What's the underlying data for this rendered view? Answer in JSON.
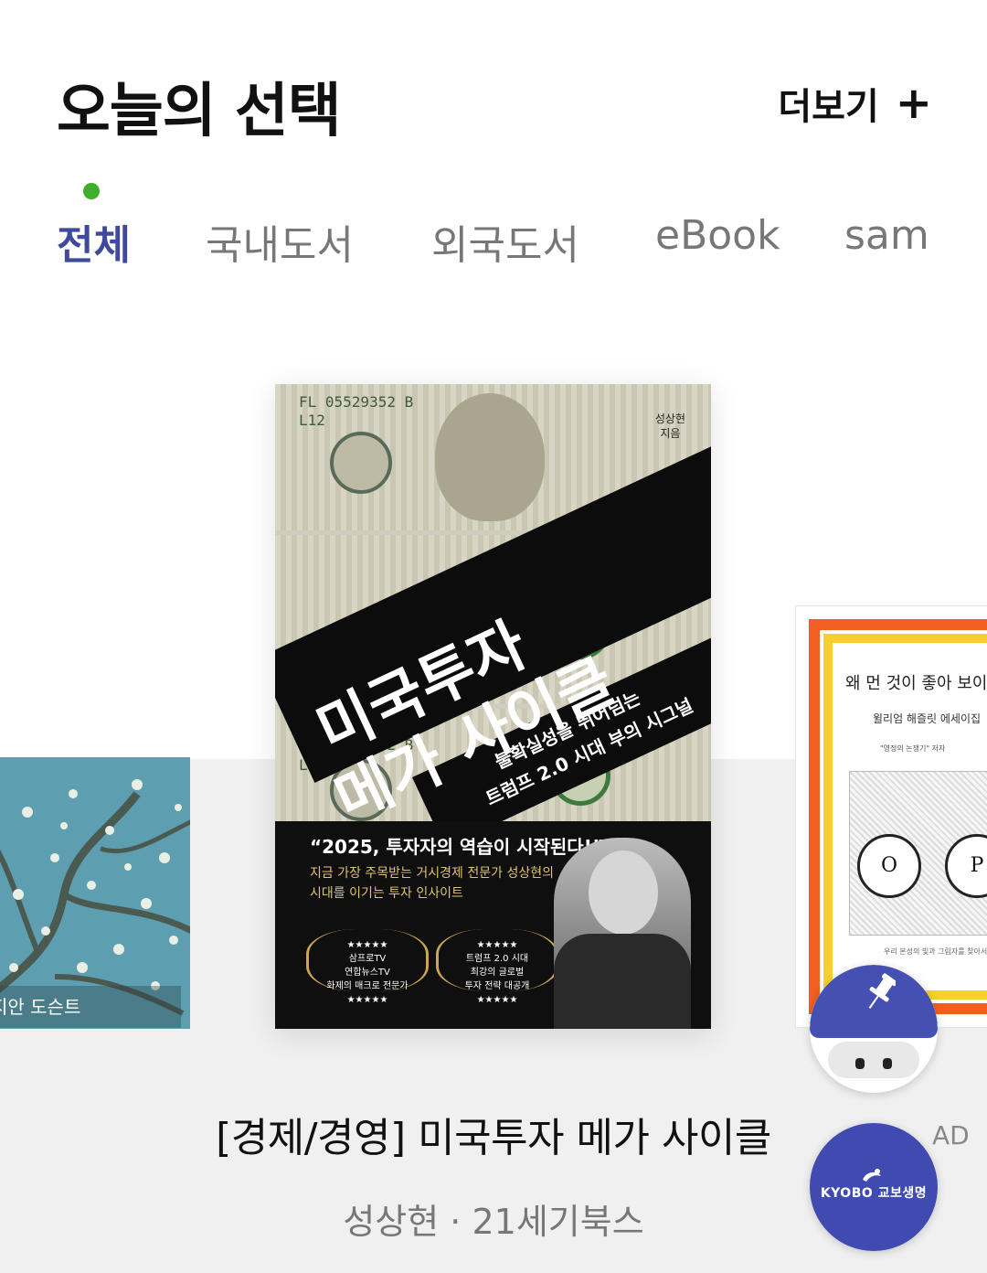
{
  "header": {
    "title": "오늘의 선택",
    "more_label": "더보기",
    "more_icon": "+"
  },
  "tabs": [
    {
      "label": "전체",
      "active": true
    },
    {
      "label": "국내도서",
      "active": false
    },
    {
      "label": "외국도서",
      "active": false
    },
    {
      "label": "eBook",
      "active": false
    },
    {
      "label": "sam",
      "active": false
    }
  ],
  "main_book": {
    "cover": {
      "title_line1": "미국투자",
      "title_line2": "메가 사이클",
      "subtitle_line1": "불확실성을 뛰어넘는",
      "subtitle_line2": "트럼프 2.0 시대 부의 시그널",
      "author_tag_line1": "성상현",
      "author_tag_line2": "지음",
      "serial": "FL 05529352 B",
      "serial_sub": "L12",
      "quote": "“2025, 투자자의 역습이 시작된다!”",
      "blurb_line1": "지금 가장 주목받는 거시경제 전문가 성상현의",
      "blurb_line2": "시대를 이기는 투자 인사이트",
      "laurel1": [
        "★★★★★",
        "삼프로TV",
        "연합뉴스TV",
        "화제의 매크로 전문가",
        "★★★★★"
      ],
      "laurel2": [
        "★★★★★",
        "트럼프 2.0 시대",
        "최강의 글로벌",
        "투자 전략 대공개",
        "★★★★★"
      ]
    },
    "title": "[경제/경영] 미국투자 메가 사이클",
    "meta": "성상현 · 21세기북스"
  },
  "left_book": {
    "cover_caption": "지안 도슨트"
  },
  "right_book": {
    "cover_title": "왜 먼 것이 좋아 보이",
    "cover_author": "윌리엄 해즐릿 에세이집",
    "cover_tag": "\"영정의 논쟁기\" 저자",
    "lens_left": "O",
    "lens_right": "P",
    "cover_foot": "우리 본성의 빛과 그림자를 찾아서"
  },
  "floating": {
    "ad_label": "AD",
    "kyobo_label": "KYOBO 교보생명"
  },
  "colors": {
    "active_tab": "#3f4a9a",
    "tab_dot": "#3fae2a",
    "fab_blue": "#3f4bb0"
  }
}
